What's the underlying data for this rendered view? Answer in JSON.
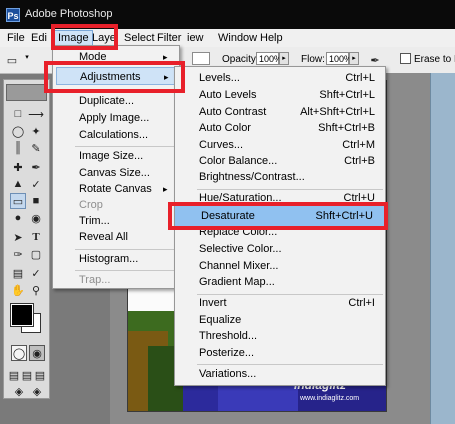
{
  "app": {
    "title": "Adobe Photoshop",
    "icon": "photoshop-app-icon"
  },
  "menubar": {
    "items": [
      "File",
      "Edit",
      "Image",
      "Layer",
      "Select",
      "Filter",
      "View",
      "Window",
      "Help"
    ],
    "visible_text": {
      "edit": "Edi",
      "layer": "Laye",
      "view": "iew"
    },
    "active": "Image"
  },
  "options_bar": {
    "opacity_label": "Opacity:",
    "opacity_value": "100%",
    "flow_label": "Flow:",
    "flow_value": "100%",
    "erase_label": "Erase to Histo",
    "erase_to_history_checked": false
  },
  "image_menu": {
    "items": [
      {
        "label": "Mode",
        "submenu": true,
        "disabled": false
      },
      {
        "label": "Adjustments",
        "submenu": true,
        "disabled": false,
        "highlighted": true
      },
      {
        "label": "Duplicate...",
        "disabled": false
      },
      {
        "label": "Apply Image...",
        "disabled": false
      },
      {
        "label": "Calculations...",
        "disabled": false
      },
      {
        "label": "Image Size...",
        "disabled": false
      },
      {
        "label": "Canvas Size...",
        "disabled": false
      },
      {
        "label": "Rotate Canvas",
        "submenu": true,
        "disabled": false
      },
      {
        "label": "Crop",
        "disabled": true
      },
      {
        "label": "Trim...",
        "disabled": false
      },
      {
        "label": "Reveal All",
        "disabled": false
      },
      {
        "label": "Histogram...",
        "disabled": false
      },
      {
        "label": "Trap...",
        "disabled": true
      }
    ]
  },
  "adjustments_menu": {
    "items": [
      {
        "label": "Levels...",
        "shortcut": "Ctrl+L"
      },
      {
        "label": "Auto Levels",
        "shortcut": "Shft+Ctrl+L"
      },
      {
        "label": "Auto Contrast",
        "shortcut": "Alt+Shft+Ctrl+L"
      },
      {
        "label": "Auto Color",
        "shortcut": "Shft+Ctrl+B"
      },
      {
        "label": "Curves...",
        "shortcut": "Ctrl+M"
      },
      {
        "label": "Color Balance...",
        "shortcut": "Ctrl+B"
      },
      {
        "label": "Brightness/Contrast...",
        "shortcut": ""
      },
      {
        "label": "Hue/Saturation...",
        "shortcut": "Ctrl+U"
      },
      {
        "label": "Desaturate",
        "shortcut": "Shft+Ctrl+U",
        "selected": true
      },
      {
        "label": "Replace Color...",
        "shortcut": ""
      },
      {
        "label": "Selective Color...",
        "shortcut": ""
      },
      {
        "label": "Channel Mixer...",
        "shortcut": ""
      },
      {
        "label": "Gradient Map...",
        "shortcut": ""
      },
      {
        "label": "Invert",
        "shortcut": "Ctrl+I"
      },
      {
        "label": "Equalize",
        "shortcut": ""
      },
      {
        "label": "Threshold...",
        "shortcut": ""
      },
      {
        "label": "Posterize...",
        "shortcut": ""
      },
      {
        "label": "Variations...",
        "shortcut": ""
      }
    ]
  },
  "watermark": {
    "text": "indiaglitz",
    "url": "www.indiaglitz.com"
  },
  "colors": {
    "callout": "#e8202a",
    "selection": "#90c1f0",
    "highlight": "#cfe3f7",
    "titlebar": "#0a0a0a"
  }
}
